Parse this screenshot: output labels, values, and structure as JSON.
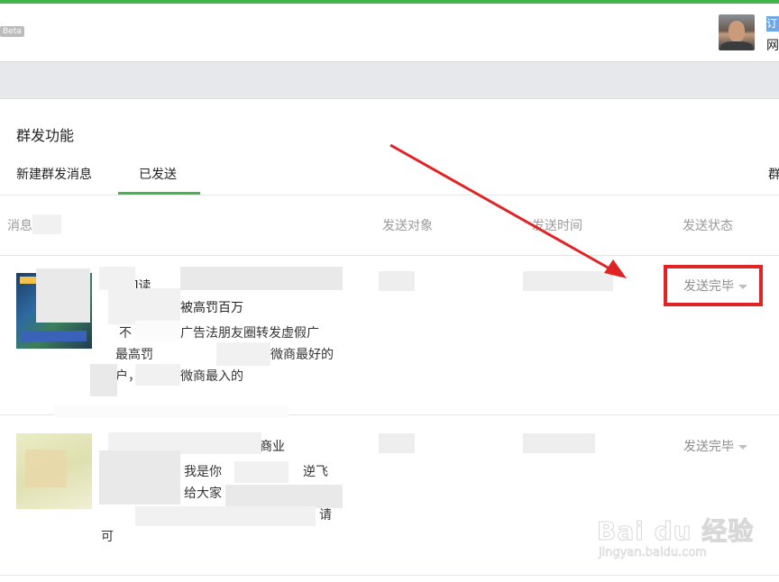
{
  "header": {
    "beta_label": "Beta",
    "user_badge": "订",
    "user_sub": "网"
  },
  "section_title": "群发功能",
  "tabs": [
    {
      "label": "新建群发消息",
      "active": false
    },
    {
      "label": "已发送",
      "active": true
    }
  ],
  "tab_more": "群",
  "table": {
    "headers": {
      "message": "消息",
      "target": "发送对象",
      "time": "发送时间",
      "status": "发送状态"
    },
    "rows": [
      {
        "title": "消息]读",
        "subtitle": "被高罚百万",
        "desc": [
          "不",
          "广告法朋友圈转发虚假广",
          "最高罚",
          "微商最好的",
          "户，对",
          "微商最入的"
        ],
        "status": "发送完毕"
      },
      {
        "title": "商业",
        "desc": [
          "我是你",
          "逆飞",
          "给大家",
          "请",
          "可"
        ],
        "status": "发送完毕"
      }
    ]
  },
  "colors": {
    "accent_green": "#44b549",
    "annotation_red": "#e02426"
  },
  "watermark": {
    "brand": "Bai du 经验",
    "url": "jingyan.baidu.com"
  }
}
